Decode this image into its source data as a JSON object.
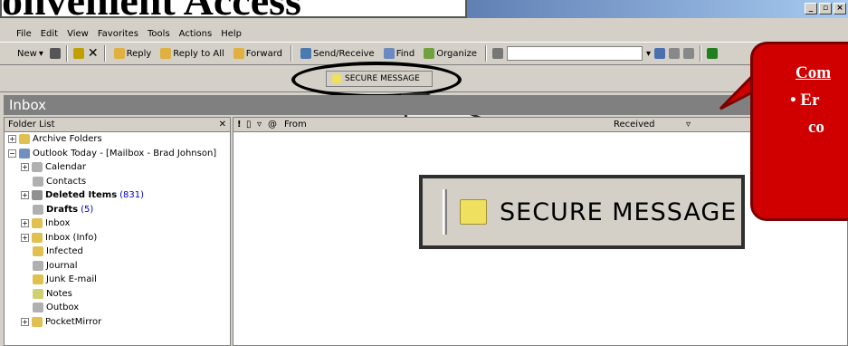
{
  "title": {
    "text": "onvenient Access"
  },
  "window": {
    "controls": [
      "_",
      "&#x1F5D7;",
      "×"
    ]
  },
  "menu": [
    "File",
    "Edit",
    "View",
    "Favorites",
    "Tools",
    "Actions",
    "Help"
  ],
  "toolbar": {
    "new": "New",
    "reply": "Reply",
    "reply_all": "Reply to All",
    "forward": "Forward",
    "send_receive": "Send/Receive",
    "find": "Find",
    "organize": "Organize"
  },
  "secure_button": {
    "label": "SECURE MESSAGE"
  },
  "inbox_bar": {
    "title": "Inbox"
  },
  "folder_list": {
    "header": "Folder List",
    "items": [
      {
        "label": "Archive Folders",
        "count": ""
      },
      {
        "label": "Outlook Today - [Mailbox - Brad Johnson]",
        "count": ""
      },
      {
        "label": "Calendar",
        "count": ""
      },
      {
        "label": "Contacts",
        "count": ""
      },
      {
        "label": "Deleted Items",
        "count": "(831)"
      },
      {
        "label": "Drafts",
        "count": "(5)"
      },
      {
        "label": "Inbox",
        "count": ""
      },
      {
        "label": "Inbox (Info)",
        "count": ""
      },
      {
        "label": "Infected",
        "count": ""
      },
      {
        "label": "Journal",
        "count": ""
      },
      {
        "label": "Junk E-mail",
        "count": ""
      },
      {
        "label": "Notes",
        "count": ""
      },
      {
        "label": "Outbox",
        "count": ""
      },
      {
        "label": "PocketMirror",
        "count": ""
      }
    ]
  },
  "message_list": {
    "from_header": "From",
    "received_header": "Received"
  },
  "callout": {
    "line1": "Com",
    "line2": "• Er",
    "line3": "co"
  }
}
